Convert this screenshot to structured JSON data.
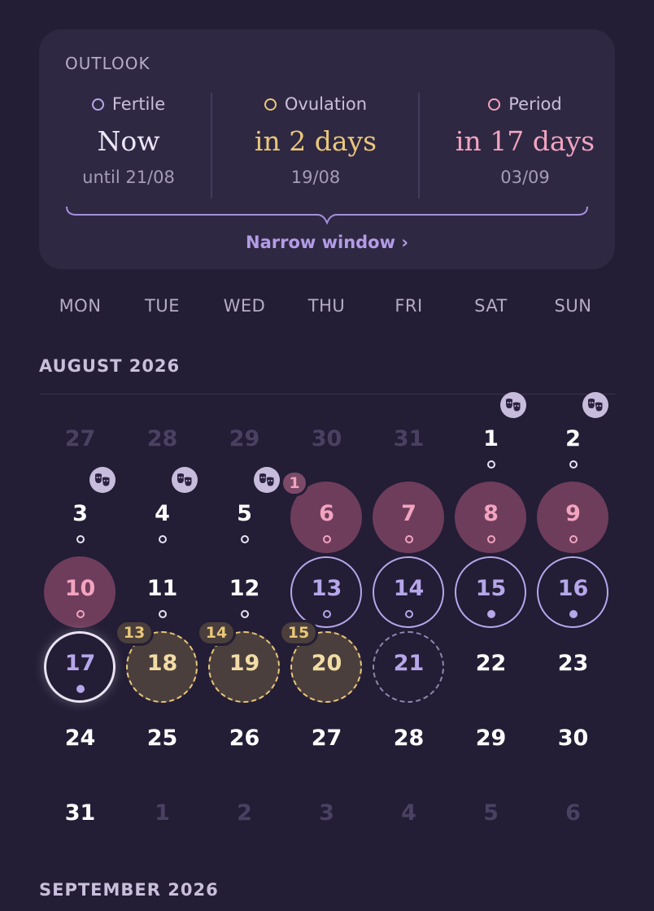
{
  "outlook": {
    "title": "OUTLOOK",
    "fertile": {
      "label": "Fertile",
      "value": "Now",
      "sub": "until 21/08",
      "color": "#b6a7ea"
    },
    "ovulation": {
      "label": "Ovulation",
      "value": "in 2 days",
      "sub": "19/08",
      "color": "#e9c77a"
    },
    "period": {
      "label": "Period",
      "value": "in 17 days",
      "sub": "03/09",
      "color": "#f2a4bf"
    },
    "narrow_link": "Narrow window ›"
  },
  "weekdays": [
    "MON",
    "TUE",
    "WED",
    "THU",
    "FRI",
    "SAT",
    "SUN"
  ],
  "months": {
    "current": "AUGUST 2026",
    "next": "SEPTEMBER 2026"
  },
  "colors": {
    "period": "#6e3d5c",
    "fertile_ring": "#b6a7ea",
    "ovulation": "#e9c77a",
    "today_ring": "#e8e2f2",
    "background": "#231d35"
  },
  "days": [
    {
      "n": "27",
      "state": "muted"
    },
    {
      "n": "28",
      "state": "muted"
    },
    {
      "n": "29",
      "state": "muted"
    },
    {
      "n": "30",
      "state": "muted"
    },
    {
      "n": "31",
      "state": "muted"
    },
    {
      "n": "1",
      "state": "normal",
      "dot": "hollow",
      "mask": true
    },
    {
      "n": "2",
      "state": "normal",
      "dot": "hollow",
      "mask": true
    },
    {
      "n": "3",
      "state": "normal",
      "dot": "hollow",
      "mask": true
    },
    {
      "n": "4",
      "state": "normal",
      "dot": "hollow",
      "mask": true
    },
    {
      "n": "5",
      "state": "normal",
      "dot": "hollow",
      "mask": true
    },
    {
      "n": "6",
      "state": "period",
      "dot": "hollow-pink",
      "badge": "1"
    },
    {
      "n": "7",
      "state": "period",
      "dot": "hollow-pink"
    },
    {
      "n": "8",
      "state": "period",
      "dot": "hollow-pink"
    },
    {
      "n": "9",
      "state": "period",
      "dot": "hollow-pink"
    },
    {
      "n": "10",
      "state": "period",
      "dot": "hollow-pink"
    },
    {
      "n": "11",
      "state": "normal",
      "dot": "hollow"
    },
    {
      "n": "12",
      "state": "normal",
      "dot": "hollow"
    },
    {
      "n": "13",
      "state": "fertile",
      "dot": "hollow-lav"
    },
    {
      "n": "14",
      "state": "fertile",
      "dot": "hollow-lav"
    },
    {
      "n": "15",
      "state": "fertile",
      "dot": "filled"
    },
    {
      "n": "16",
      "state": "fertile",
      "dot": "filled"
    },
    {
      "n": "17",
      "state": "today",
      "dot": "filled"
    },
    {
      "n": "18",
      "state": "ovulation",
      "badge": "13"
    },
    {
      "n": "19",
      "state": "ovulation",
      "badge": "14"
    },
    {
      "n": "20",
      "state": "ovulation",
      "badge": "15"
    },
    {
      "n": "21",
      "state": "predicted"
    },
    {
      "n": "22",
      "state": "normal"
    },
    {
      "n": "23",
      "state": "normal"
    },
    {
      "n": "24",
      "state": "normal"
    },
    {
      "n": "25",
      "state": "normal"
    },
    {
      "n": "26",
      "state": "normal"
    },
    {
      "n": "27",
      "state": "normal"
    },
    {
      "n": "28",
      "state": "normal"
    },
    {
      "n": "29",
      "state": "normal"
    },
    {
      "n": "30",
      "state": "normal"
    },
    {
      "n": "31",
      "state": "normal"
    },
    {
      "n": "1",
      "state": "muted"
    },
    {
      "n": "2",
      "state": "muted"
    },
    {
      "n": "3",
      "state": "muted"
    },
    {
      "n": "4",
      "state": "muted"
    },
    {
      "n": "5",
      "state": "muted"
    },
    {
      "n": "6",
      "state": "muted"
    }
  ]
}
